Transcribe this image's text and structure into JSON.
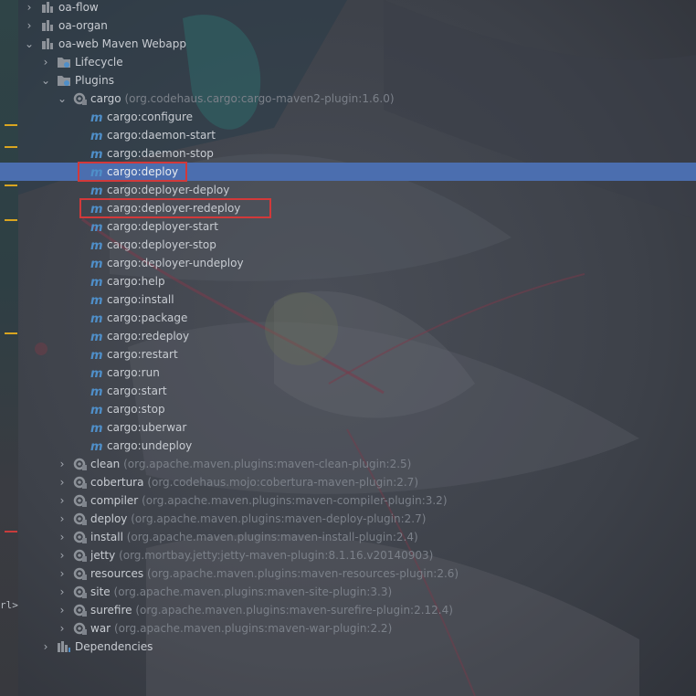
{
  "tree": {
    "root_items": [
      {
        "label": "oa-flow",
        "expanded": false
      },
      {
        "label": "oa-organ",
        "expanded": false
      },
      {
        "label": "oa-web Maven Webapp",
        "expanded": true
      }
    ],
    "folders": {
      "lifecycle": "Lifecycle",
      "plugins": "Plugins",
      "dependencies": "Dependencies"
    },
    "cargo": {
      "name": "cargo",
      "coord": "(org.codehaus.cargo:cargo-maven2-plugin:1.6.0)",
      "goals": [
        "cargo:configure",
        "cargo:daemon-start",
        "cargo:daemon-stop",
        "cargo:deploy",
        "cargo:deployer-deploy",
        "cargo:deployer-redeploy",
        "cargo:deployer-start",
        "cargo:deployer-stop",
        "cargo:deployer-undeploy",
        "cargo:help",
        "cargo:install",
        "cargo:package",
        "cargo:redeploy",
        "cargo:restart",
        "cargo:run",
        "cargo:start",
        "cargo:stop",
        "cargo:uberwar",
        "cargo:undeploy"
      ],
      "selected_goal": "cargo:deploy",
      "highlighted_goals": [
        "cargo:deploy",
        "cargo:deployer-redeploy"
      ]
    },
    "plugins": [
      {
        "name": "clean",
        "coord": "(org.apache.maven.plugins:maven-clean-plugin:2.5)"
      },
      {
        "name": "cobertura",
        "coord": "(org.codehaus.mojo:cobertura-maven-plugin:2.7)"
      },
      {
        "name": "compiler",
        "coord": "(org.apache.maven.plugins:maven-compiler-plugin:3.2)"
      },
      {
        "name": "deploy",
        "coord": "(org.apache.maven.plugins:maven-deploy-plugin:2.7)"
      },
      {
        "name": "install",
        "coord": "(org.apache.maven.plugins:maven-install-plugin:2.4)"
      },
      {
        "name": "jetty",
        "coord": "(org.mortbay.jetty:jetty-maven-plugin:8.1.16.v20140903)"
      },
      {
        "name": "resources",
        "coord": "(org.apache.maven.plugins:maven-resources-plugin:2.6)"
      },
      {
        "name": "site",
        "coord": "(org.apache.maven.plugins:maven-site-plugin:3.3)"
      },
      {
        "name": "surefire",
        "coord": "(org.apache.maven.plugins:maven-surefire-plugin:2.12.4)"
      },
      {
        "name": "war",
        "coord": "(org.apache.maven.plugins:maven-war-plugin:2.2)"
      }
    ]
  },
  "gutter": {
    "code_fragment": "rl>"
  },
  "colors": {
    "selection": "#4b6eaf",
    "highlight_box": "#d2393a",
    "text": "#c8ccd2",
    "coord_text": "#7b8089",
    "gutter_mark": "#d9a520"
  }
}
